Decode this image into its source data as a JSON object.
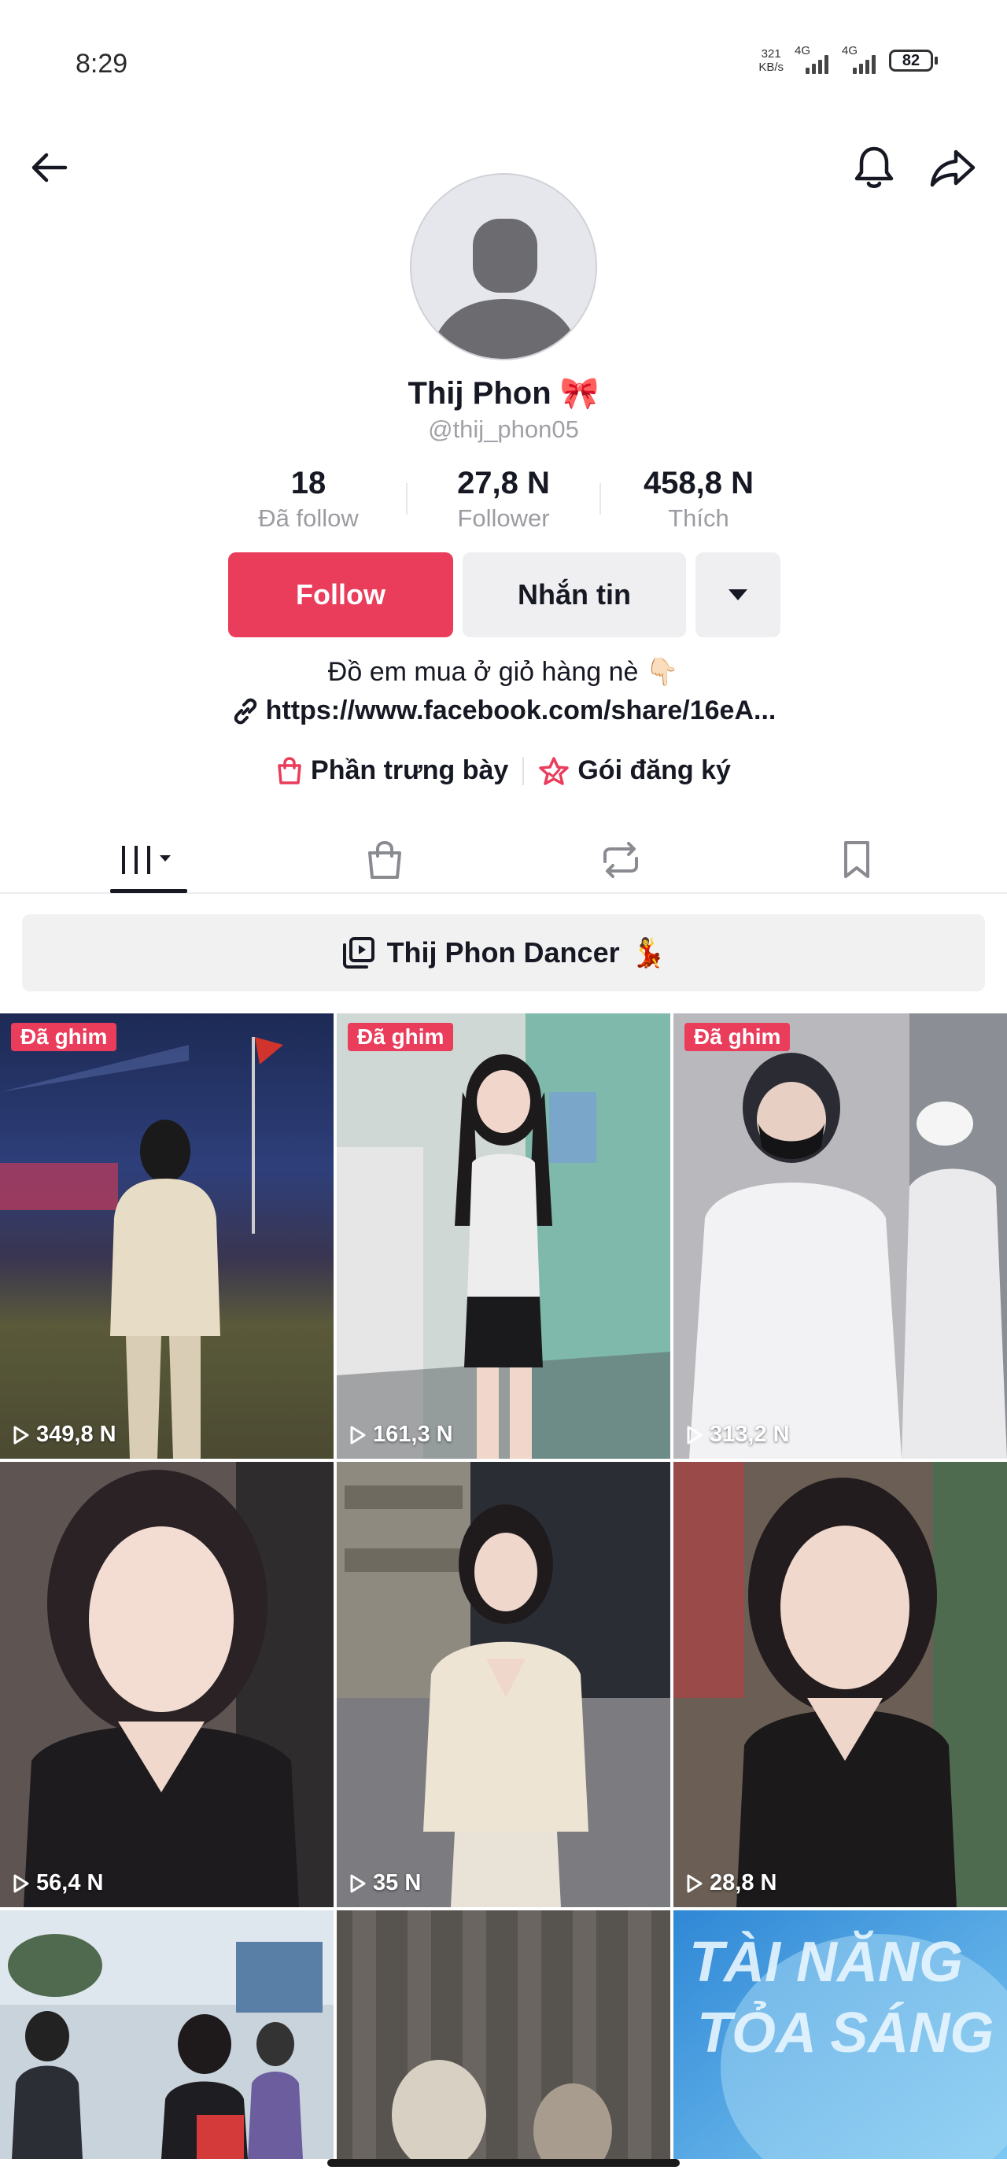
{
  "status_bar": {
    "time": "8:29",
    "net_speed_value": "321",
    "net_speed_unit": "KB/s",
    "sim1_label": "4G",
    "sim2_label": "4G",
    "battery": "82"
  },
  "profile": {
    "name": "Thij Phon",
    "name_emoji": "🎀",
    "username": "@thij_phon05",
    "stats": [
      {
        "value": "18",
        "label": "Đã follow"
      },
      {
        "value": "27,8 N",
        "label": "Follower"
      },
      {
        "value": "458,8 N",
        "label": "Thích"
      }
    ],
    "follow_label": "Follow",
    "message_label": "Nhắn tin",
    "bio": "Đồ em mua ở giỏ hàng  nè 👇🏻",
    "link": "https://www.facebook.com/share/16eA...",
    "showcase_label": "Phần trưng bày",
    "subscription_label": "Gói đăng ký"
  },
  "playlist": {
    "title": "Thij Phon Dancer",
    "emoji": "💃"
  },
  "videos": [
    {
      "pinned": "Đã ghim",
      "views": "349,8 N"
    },
    {
      "pinned": "Đã ghim",
      "views": "161,3 N"
    },
    {
      "pinned": "Đã ghim",
      "views": "313,2 N"
    },
    {
      "pinned": "",
      "views": "56,4 N"
    },
    {
      "pinned": "",
      "views": "35 N"
    },
    {
      "pinned": "",
      "views": "28,8 N"
    },
    {
      "pinned": "",
      "views": ""
    },
    {
      "pinned": "",
      "views": ""
    },
    {
      "pinned": "",
      "views": ""
    }
  ],
  "overlay_text": {
    "tile9_line1": "TÀI NĂNG",
    "tile9_line2": "TỎA SÁNG"
  },
  "colors": {
    "accent": "#ea3c5b",
    "pinned_badge": "#ea3c5b"
  },
  "icons": {
    "back": "back-arrow-icon",
    "notifications": "bell-icon",
    "share": "share-icon"
  }
}
